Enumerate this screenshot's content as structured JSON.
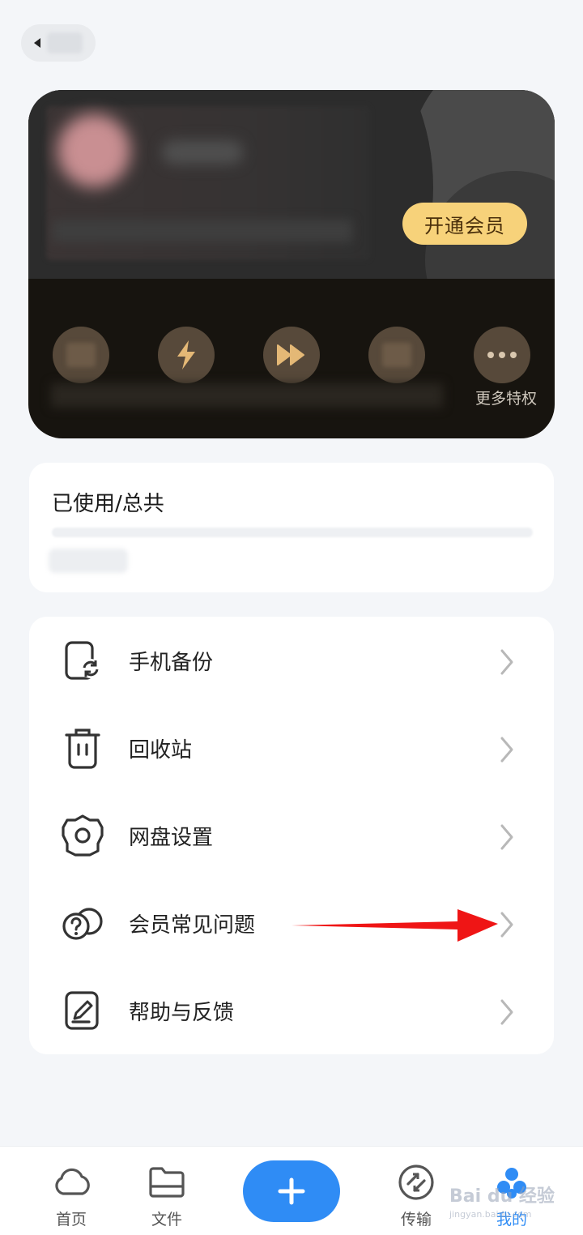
{
  "header": {
    "back_icon": "back-arrow-icon"
  },
  "vip_card": {
    "open_button": "开通会员",
    "more_label": "更多特权",
    "icons": [
      "privilege-1-icon",
      "lightning-icon",
      "fast-forward-icon",
      "privilege-4-icon",
      "more-dots-icon"
    ],
    "accent_color": "#f7d27a"
  },
  "storage": {
    "title": "已使用/总共"
  },
  "menu": {
    "items": [
      {
        "label": "手机备份",
        "icon": "phone-backup-icon"
      },
      {
        "label": "回收站",
        "icon": "trash-icon"
      },
      {
        "label": "网盘设置",
        "icon": "settings-gear-icon"
      },
      {
        "label": "会员常见问题",
        "icon": "faq-question-icon"
      },
      {
        "label": "帮助与反馈",
        "icon": "feedback-edit-icon"
      }
    ]
  },
  "tabbar": {
    "tabs": [
      {
        "label": "首页",
        "icon": "cloud-icon"
      },
      {
        "label": "文件",
        "icon": "folder-icon"
      },
      {
        "label": "",
        "icon": "plus-icon"
      },
      {
        "label": "传输",
        "icon": "transfer-icon"
      },
      {
        "label": "我的",
        "icon": "profile-icon"
      }
    ],
    "active_color": "#2f8cf5"
  },
  "watermark": {
    "text": "Bai du 经验",
    "sub": "jingyan.baidu.com"
  }
}
